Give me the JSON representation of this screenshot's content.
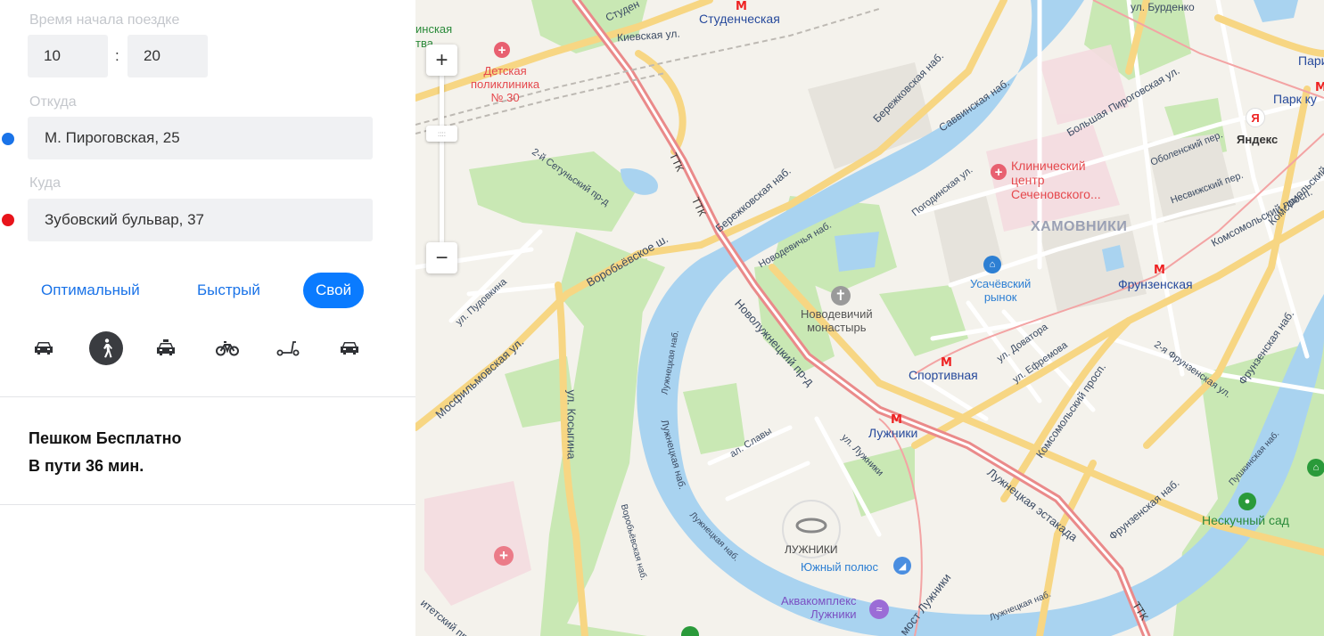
{
  "trip": {
    "start_time_label": "Время начала поездке",
    "hours": "10",
    "separator": ":",
    "minutes": "20",
    "from_label": "Откуда",
    "from_value": "М. Пироговская, 25",
    "to_label": "Куда",
    "to_value": "Зубовский бульвар, 37",
    "from_dot_color": "#1a73e8",
    "to_dot_color": "#e8141b"
  },
  "route_modes": {
    "optimal": "Оптимальный",
    "fast": "Быстрый",
    "custom": "Свой",
    "selected": "custom"
  },
  "transport": {
    "icons": [
      "car-icon",
      "pedestrian-icon",
      "taxi-icon",
      "bicycle-icon",
      "scooter-icon",
      "car-sharing-icon"
    ],
    "selected": "pedestrian-icon"
  },
  "result": {
    "line1": "Пешком Бесплатно",
    "line2": "В пути 36 мин."
  },
  "map": {
    "zoom_in": "+",
    "zoom_out": "−",
    "zoom_handle": "::::",
    "labels": {
      "ul_burdenko": "ул. Бурденко",
      "studencheskaya": "Студенческая",
      "studen": "Студен",
      "kievskaya": "Киевская ул.",
      "inskaya": "инская",
      "tva": "тва",
      "clinic_30": "Детская\nполиклиника\n№ 30",
      "park_kul_1": "Пари",
      "park_kul_2": "Парк ку",
      "yandex": "Яндекс",
      "berezhk_1": "Бережковская наб.",
      "berezhk_2": "Бережковская наб.",
      "savvinskaya": "Саввинская наб.",
      "b_pirogovskaya": "Большая Пироговская ул.",
      "obolensky": "Оболенский пер.",
      "komsomolsky_1": "Комсомольский просп.",
      "nesvizhsky": "Несвижский пер.",
      "komsomolsky_2": "Комсомольский просп.",
      "komsomolsky_3": "Комсомольский просп.",
      "pogodinskaya": "Погодинская ул.",
      "clinic_sech": "Клинический\nцентр\nСеченовского...",
      "khamovniki": "ХАМОВНИКИ",
      "ttk_1": "ТТК",
      "ttk_2": "ТТК",
      "ttk_3": "ТТК",
      "segunsky": "2-й Сетуньский пр-д",
      "novodevichya": "Новодевичья наб.",
      "usachevsky": "Усачёвский\nрынок",
      "frunzenskaya": "Фрунзенская",
      "vorobyovskoe": "Воробьёвское ш.",
      "pudovkina": "ул. Пудовкина",
      "novodevichy_mon": "Новодевичий\nмонастырь",
      "mosfilm": "Мосфильмовская ул.",
      "novoluzh": "Новолужнецкий пр-д",
      "dovatora": "ул. Доватора",
      "efremova": "ул. Ефремова",
      "frunz_2": "2-я Фрунзенская ул.",
      "frunz_nab_1": "Фрунзенская наб.",
      "frunz_nab_2": "Фрунзенская наб.",
      "sportivnaya": "Спортивная",
      "luzh_nab_1": "Лужнецкая наб.",
      "luzh_nab_2": "Лужнецкая наб.",
      "luzh_nab_3": "Лужнецкая наб.",
      "luzh_nab_4": "Лужнецкая наб.",
      "kosygina": "ул. Косыгина",
      "luzhniki_metro": "Лужники",
      "al_slavy": "ал. Славы",
      "ul_luzhniki": "ул. Лужники",
      "vorob_nab": "Воробьёвская наб.",
      "luzh_estakada": "Лужнецкая эстакада",
      "pushkinskaya": "Пушкинская наб.",
      "neskuchny": "Нескучный сад",
      "luzhniki_stadium": "ЛУЖНИКИ",
      "yuzhny_polyus": "Южный полюс",
      "aquacomplex": "Аквакомплекс\nЛужники",
      "most_luzhniki": "мост Лужники",
      "ttk_4": "ТТК",
      "itetsky": "итетский пр"
    },
    "colors": {
      "river": "#a9d3f0",
      "park": "#c9e8b4",
      "road_major": "#f7d683",
      "road_ttk": "#ea8a8a",
      "background": "#f4f2ec"
    }
  }
}
